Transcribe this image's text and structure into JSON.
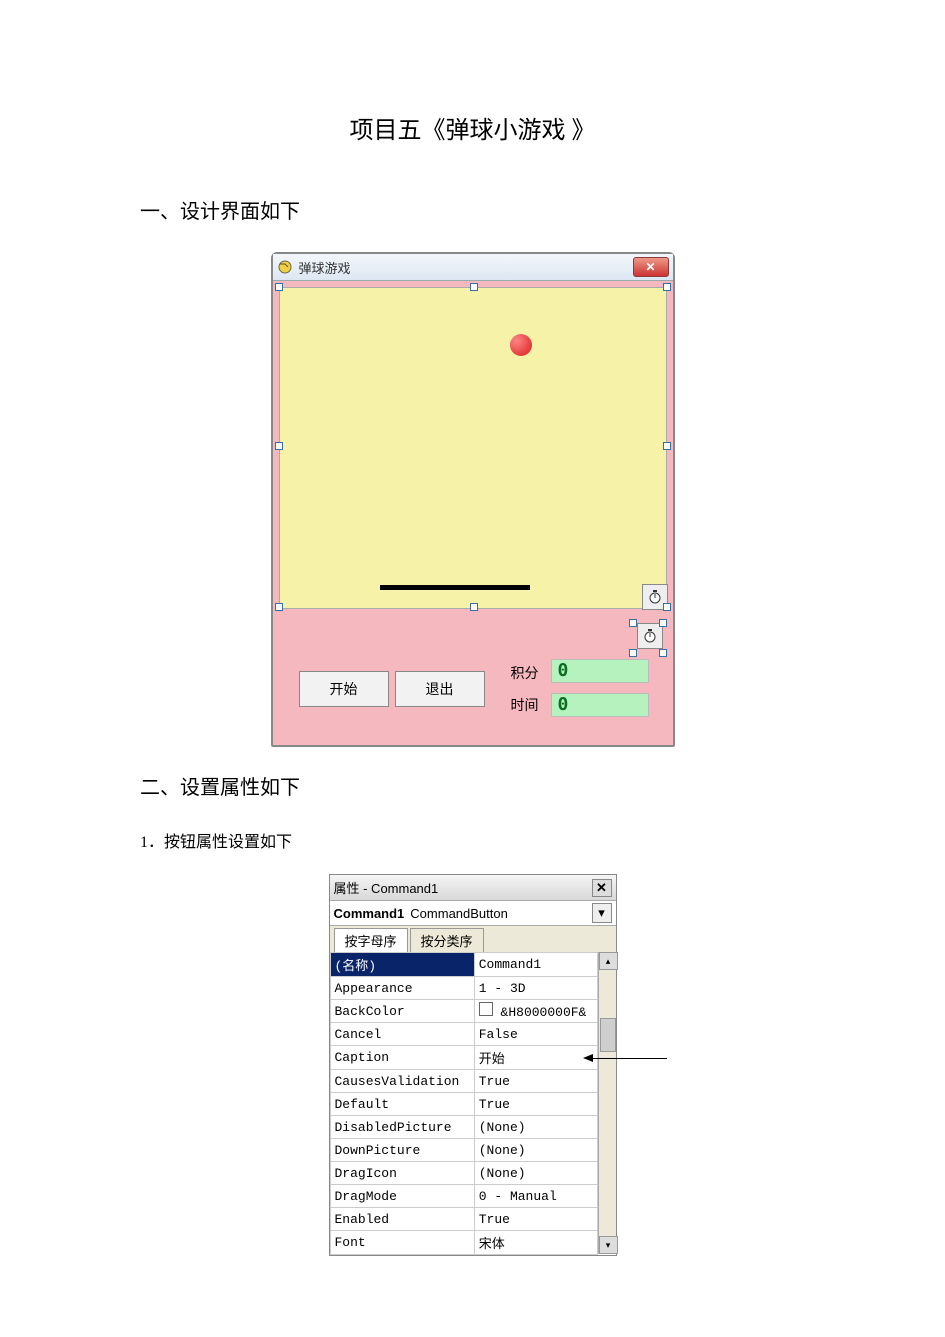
{
  "doc": {
    "title": "项目五《弹球小游戏 》",
    "section1": "一、设计界面如下",
    "section2": "二、设置属性如下",
    "section2_1": "1．按钮属性设置如下"
  },
  "form": {
    "title": "弹球游戏",
    "btn_start": "开始",
    "btn_quit": "退出",
    "lbl_score": "积分",
    "lbl_time": "时间",
    "val_score": "0",
    "val_time": "0"
  },
  "prop": {
    "panel_title": "属性 - Command1",
    "object_name": "Command1",
    "object_type": "CommandButton",
    "tab_alpha": "按字母序",
    "tab_cat": "按分类序",
    "rows": [
      {
        "k": "(名称)",
        "v": "Command1",
        "sel": true
      },
      {
        "k": "Appearance",
        "v": "1 - 3D"
      },
      {
        "k": "BackColor",
        "v": "&H8000000F&",
        "color": true
      },
      {
        "k": "Cancel",
        "v": "False"
      },
      {
        "k": "Caption",
        "v": "开始",
        "callout": true
      },
      {
        "k": "CausesValidation",
        "v": "True"
      },
      {
        "k": "Default",
        "v": "True"
      },
      {
        "k": "DisabledPicture",
        "v": "(None)"
      },
      {
        "k": "DownPicture",
        "v": "(None)"
      },
      {
        "k": "DragIcon",
        "v": "(None)"
      },
      {
        "k": "DragMode",
        "v": "0 - Manual"
      },
      {
        "k": "Enabled",
        "v": "True"
      },
      {
        "k": "Font",
        "v": "宋体"
      }
    ]
  }
}
